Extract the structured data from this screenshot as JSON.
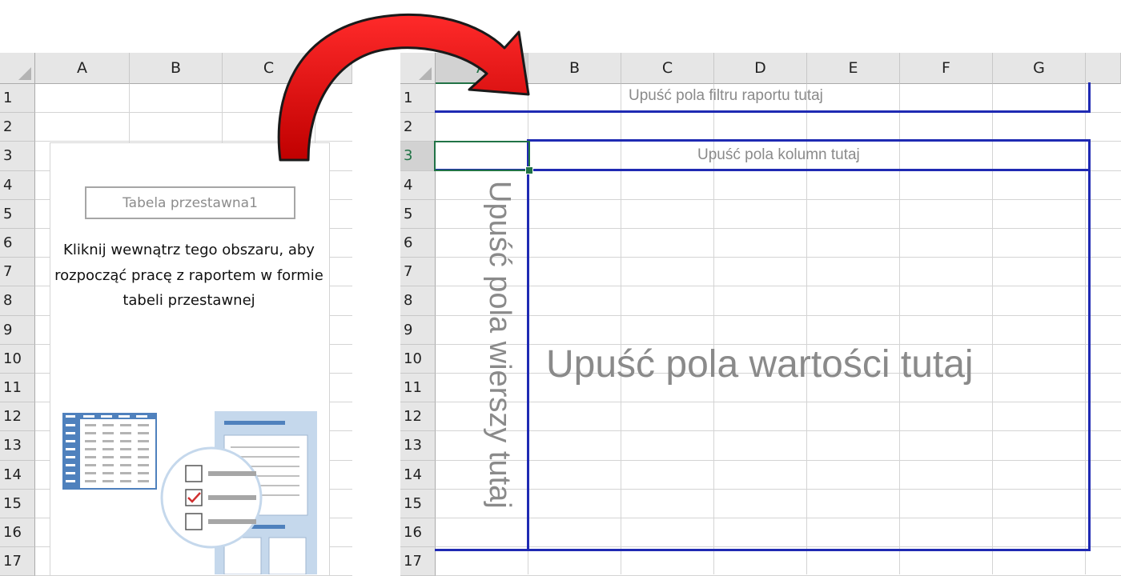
{
  "left_sheet": {
    "columns": [
      "A",
      "B",
      "C"
    ],
    "rows": [
      "1",
      "2",
      "3",
      "4",
      "5",
      "6",
      "7",
      "8",
      "9",
      "10",
      "11",
      "12",
      "13",
      "14",
      "15",
      "16",
      "17"
    ],
    "pivot_name": "Tabela przestawna1",
    "pivot_message": "Kliknij wewnątrz tego obszaru, aby rozpocząć pracę z raportem w formie tabeli przestawnej"
  },
  "right_sheet": {
    "columns": [
      "A",
      "B",
      "C",
      "D",
      "E",
      "F",
      "G"
    ],
    "rows": [
      "1",
      "2",
      "3",
      "4",
      "5",
      "6",
      "7",
      "8",
      "9",
      "10",
      "11",
      "12",
      "13",
      "14",
      "15",
      "16",
      "17"
    ],
    "selected_column": "A",
    "selected_row": "3",
    "drop_filter": "Upuść pola filtru raportu tutaj",
    "drop_columns": "Upuść pola kolumn tutaj",
    "drop_rows": "Upuść pola wierszy tutaj",
    "drop_values": "Upuść pola wartości tutaj"
  },
  "colors": {
    "pivot_border": "#1f2ab3",
    "selection": "#217346",
    "arrow": "#e00000",
    "icon_blue": "#4f81bd"
  }
}
